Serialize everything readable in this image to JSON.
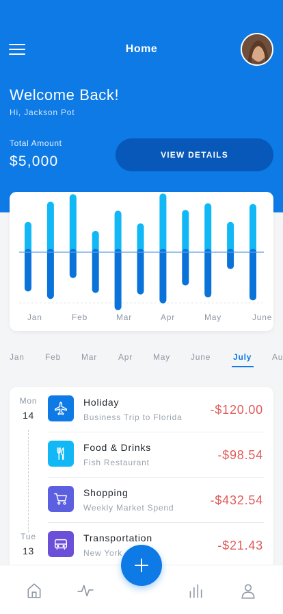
{
  "header": {
    "title": "Home",
    "welcome": "Welcome Back!",
    "greeting": "Hi, Jackson Pot",
    "total_label": "Total Amount",
    "total_value": "$5,000",
    "view_details_label": "VIEW DETAILS",
    "bg_color": "#0d7ae6"
  },
  "chart_data": {
    "type": "bar",
    "categories": [
      "Jan",
      "Feb",
      "Mar",
      "Apr",
      "May",
      "June"
    ],
    "tick_labels": [
      "Jan",
      "Feb",
      "Mar",
      "Apr",
      "May",
      "June"
    ],
    "series": [
      {
        "values": [
          36,
          63,
          73,
          24,
          51,
          34,
          74,
          52,
          61,
          36,
          60
        ]
      },
      {
        "values": [
          -48,
          -58,
          -30,
          -50,
          -73,
          -52,
          -64,
          -40,
          -56,
          -18,
          -60
        ]
      }
    ],
    "ylim": [
      -80,
      80
    ],
    "colors": [
      "#12b8f5",
      "#0a73d9"
    ],
    "grid": true
  },
  "months": {
    "tabs": [
      "Jan",
      "Feb",
      "Mar",
      "Apr",
      "May",
      "June",
      "July",
      "Au"
    ],
    "active": "July"
  },
  "transactions": {
    "groups": [
      {
        "dow": "Mon",
        "day": "14"
      },
      {
        "dow": "Tue",
        "day": "13"
      }
    ],
    "items": [
      {
        "title": "Holiday",
        "subtitle": "Business Trip to Florida",
        "amount": "-$120.00",
        "icon": "airplane-icon",
        "color": "#0d7ae6"
      },
      {
        "title": "Food & Drinks",
        "subtitle": "Fish Restaurant",
        "amount": "-$98.54",
        "icon": "cutlery-icon",
        "color": "#12b8f5"
      },
      {
        "title": "Shopping",
        "subtitle": "Weekly Market Spend",
        "amount": "-$432.54",
        "icon": "cart-icon",
        "color": "#5b5fe0"
      },
      {
        "title": "Transportation",
        "subtitle": "New York",
        "amount": "-$21.43",
        "icon": "bus-icon",
        "color": "#6b4fd8"
      }
    ]
  },
  "bottom_nav": {
    "items": [
      "home-icon",
      "activity-icon",
      "stats-icon",
      "profile-icon"
    ],
    "fab_icon": "plus-icon"
  }
}
